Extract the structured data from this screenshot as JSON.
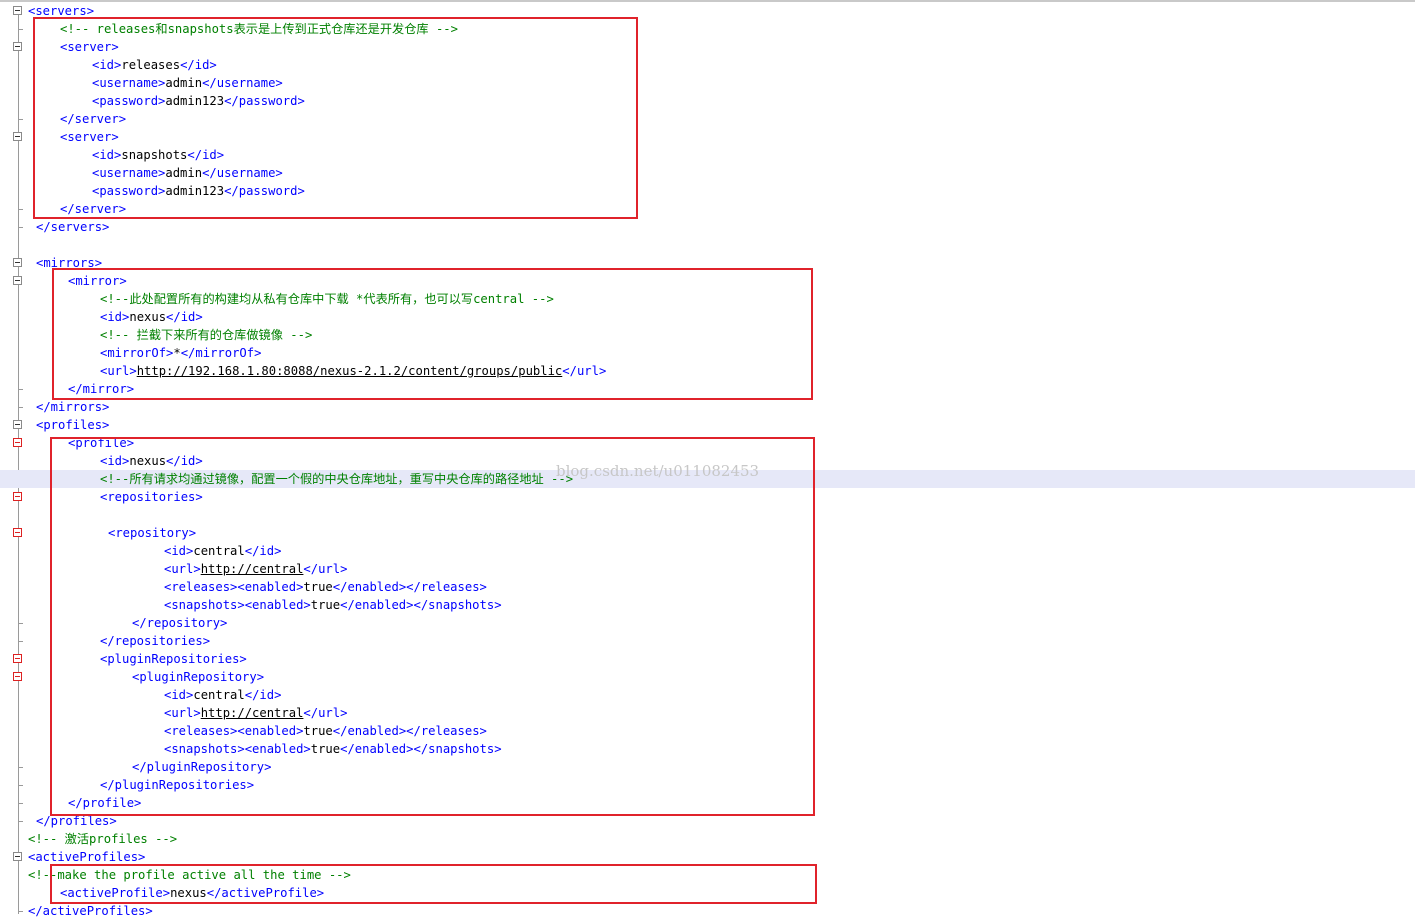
{
  "watermark": "blog.csdn.net/u011082453",
  "lines": [
    {
      "indent": 0,
      "fold": "box",
      "segs": [
        [
          "tag",
          "<servers>"
        ]
      ]
    },
    {
      "indent": 4,
      "fold": "tick",
      "segs": [
        [
          "cmt",
          "<!-- releases和snapshots表示是上传到正式仓库还是开发仓库 -->"
        ]
      ]
    },
    {
      "indent": 4,
      "fold": "box",
      "segs": [
        [
          "tag",
          "<server>"
        ]
      ]
    },
    {
      "indent": 8,
      "fold": "line",
      "segs": [
        [
          "tag",
          "<id>"
        ],
        [
          "txt",
          "releases"
        ],
        [
          "tag",
          "</id>"
        ]
      ]
    },
    {
      "indent": 8,
      "fold": "line",
      "segs": [
        [
          "tag",
          "<username>"
        ],
        [
          "txt",
          "admin"
        ],
        [
          "tag",
          "</username>"
        ]
      ]
    },
    {
      "indent": 8,
      "fold": "line",
      "segs": [
        [
          "tag",
          "<password>"
        ],
        [
          "txt",
          "admin123"
        ],
        [
          "tag",
          "</password>"
        ]
      ]
    },
    {
      "indent": 4,
      "fold": "tick",
      "segs": [
        [
          "tag",
          "</server>"
        ]
      ]
    },
    {
      "indent": 4,
      "fold": "box",
      "segs": [
        [
          "tag",
          "<server>"
        ]
      ]
    },
    {
      "indent": 8,
      "fold": "line",
      "segs": [
        [
          "tag",
          "<id>"
        ],
        [
          "txt",
          "snapshots"
        ],
        [
          "tag",
          "</id>"
        ]
      ]
    },
    {
      "indent": 8,
      "fold": "line",
      "segs": [
        [
          "tag",
          "<username>"
        ],
        [
          "txt",
          "admin"
        ],
        [
          "tag",
          "</username>"
        ]
      ]
    },
    {
      "indent": 8,
      "fold": "line",
      "segs": [
        [
          "tag",
          "<password>"
        ],
        [
          "txt",
          "admin123"
        ],
        [
          "tag",
          "</password>"
        ]
      ]
    },
    {
      "indent": 4,
      "fold": "tick",
      "segs": [
        [
          "tag",
          "</server>"
        ]
      ]
    },
    {
      "indent": 1,
      "fold": "tick",
      "segs": [
        [
          "tag",
          "</servers>"
        ]
      ]
    },
    {
      "indent": 0,
      "fold": "line",
      "segs": []
    },
    {
      "indent": 1,
      "fold": "box",
      "segs": [
        [
          "tag",
          "<mirrors>"
        ]
      ]
    },
    {
      "indent": 5,
      "fold": "box",
      "segs": [
        [
          "tag",
          "<mirror>"
        ]
      ]
    },
    {
      "indent": 9,
      "fold": "line",
      "segs": [
        [
          "cmt",
          "<!--此处配置所有的构建均从私有仓库中下载 *代表所有，也可以写central -->"
        ]
      ]
    },
    {
      "indent": 9,
      "fold": "line",
      "segs": [
        [
          "tag",
          "<id>"
        ],
        [
          "txt",
          "nexus"
        ],
        [
          "tag",
          "</id>"
        ]
      ]
    },
    {
      "indent": 9,
      "fold": "line",
      "segs": [
        [
          "cmt",
          "<!-- 拦截下来所有的仓库做镜像 -->"
        ]
      ]
    },
    {
      "indent": 9,
      "fold": "line",
      "segs": [
        [
          "tag",
          "<mirrorOf>"
        ],
        [
          "txt",
          "*"
        ],
        [
          "tag",
          "</mirrorOf>"
        ]
      ]
    },
    {
      "indent": 9,
      "fold": "line",
      "segs": [
        [
          "tag",
          "<url>"
        ],
        [
          "lnk",
          "http://192.168.1.80:8088/nexus-2.1.2/content/groups/public"
        ],
        [
          "tag",
          "</url>"
        ]
      ]
    },
    {
      "indent": 5,
      "fold": "tick",
      "segs": [
        [
          "tag",
          "</mirror>"
        ]
      ]
    },
    {
      "indent": 1,
      "fold": "tick",
      "segs": [
        [
          "tag",
          "</mirrors>"
        ]
      ]
    },
    {
      "indent": 1,
      "fold": "box",
      "segs": [
        [
          "tag",
          "<profiles>"
        ]
      ]
    },
    {
      "indent": 5,
      "fold": "red",
      "segs": [
        [
          "tag",
          "<profile>"
        ]
      ]
    },
    {
      "indent": 9,
      "fold": "line",
      "segs": [
        [
          "tag",
          "<id>"
        ],
        [
          "txt",
          "nexus"
        ],
        [
          "tag",
          "</id>"
        ]
      ]
    },
    {
      "indent": 9,
      "fold": "line",
      "hl": true,
      "segs": [
        [
          "cmt",
          "<!--所有请求均通过镜像，配置一个假的中央仓库地址，重写中央仓库的路径地址 -->"
        ]
      ]
    },
    {
      "indent": 9,
      "fold": "red",
      "segs": [
        [
          "tag",
          "<repositories>"
        ]
      ]
    },
    {
      "indent": 0,
      "fold": "line",
      "segs": []
    },
    {
      "indent": 10,
      "fold": "red",
      "segs": [
        [
          "tag",
          "<repository>"
        ]
      ]
    },
    {
      "indent": 17,
      "fold": "line",
      "segs": [
        [
          "tag",
          "<id>"
        ],
        [
          "txt",
          "central"
        ],
        [
          "tag",
          "</id>"
        ]
      ]
    },
    {
      "indent": 17,
      "fold": "line",
      "segs": [
        [
          "tag",
          "<url>"
        ],
        [
          "lnk",
          "http://central"
        ],
        [
          "tag",
          "</url>"
        ]
      ]
    },
    {
      "indent": 17,
      "fold": "line",
      "segs": [
        [
          "tag",
          "<releases><enabled>"
        ],
        [
          "txt",
          "true"
        ],
        [
          "tag",
          "</enabled></releases>"
        ]
      ]
    },
    {
      "indent": 17,
      "fold": "line",
      "segs": [
        [
          "tag",
          "<snapshots><enabled>"
        ],
        [
          "txt",
          "true"
        ],
        [
          "tag",
          "</enabled></snapshots>"
        ]
      ]
    },
    {
      "indent": 13,
      "fold": "tick",
      "segs": [
        [
          "tag",
          "</repository>"
        ]
      ]
    },
    {
      "indent": 9,
      "fold": "tick",
      "segs": [
        [
          "tag",
          "</repositories>"
        ]
      ]
    },
    {
      "indent": 9,
      "fold": "red",
      "segs": [
        [
          "tag",
          "<pluginRepositories>"
        ]
      ]
    },
    {
      "indent": 13,
      "fold": "red",
      "segs": [
        [
          "tag",
          "<pluginRepository>"
        ]
      ]
    },
    {
      "indent": 17,
      "fold": "line",
      "segs": [
        [
          "tag",
          "<id>"
        ],
        [
          "txt",
          "central"
        ],
        [
          "tag",
          "</id>"
        ]
      ]
    },
    {
      "indent": 17,
      "fold": "line",
      "segs": [
        [
          "tag",
          "<url>"
        ],
        [
          "lnk",
          "http://central"
        ],
        [
          "tag",
          "</url>"
        ]
      ]
    },
    {
      "indent": 17,
      "fold": "line",
      "segs": [
        [
          "tag",
          "<releases><enabled>"
        ],
        [
          "txt",
          "true"
        ],
        [
          "tag",
          "</enabled></releases>"
        ]
      ]
    },
    {
      "indent": 17,
      "fold": "line",
      "segs": [
        [
          "tag",
          "<snapshots><enabled>"
        ],
        [
          "txt",
          "true"
        ],
        [
          "tag",
          "</enabled></snapshots>"
        ]
      ]
    },
    {
      "indent": 13,
      "fold": "tick",
      "segs": [
        [
          "tag",
          "</pluginRepository>"
        ]
      ]
    },
    {
      "indent": 9,
      "fold": "tick",
      "segs": [
        [
          "tag",
          "</pluginRepositories>"
        ]
      ]
    },
    {
      "indent": 5,
      "fold": "tick",
      "segs": [
        [
          "tag",
          "</profile>"
        ]
      ]
    },
    {
      "indent": 1,
      "fold": "tick",
      "segs": [
        [
          "tag",
          "</profiles>"
        ]
      ]
    },
    {
      "indent": 0,
      "fold": "line",
      "segs": [
        [
          "cmt",
          "<!-- 激活profiles -->"
        ]
      ]
    },
    {
      "indent": 0,
      "fold": "box",
      "segs": [
        [
          "tag",
          "<activeProfiles>"
        ]
      ]
    },
    {
      "indent": 0,
      "fold": "line",
      "segs": [
        [
          "cmt",
          "<!--make the profile active all the time -->"
        ]
      ]
    },
    {
      "indent": 4,
      "fold": "line",
      "segs": [
        [
          "tag",
          "<activeProfile>"
        ],
        [
          "txt",
          "nexus"
        ],
        [
          "tag",
          "</activeProfile>"
        ]
      ]
    },
    {
      "indent": 0,
      "fold": "tick",
      "segs": [
        [
          "tag",
          "</activeProfiles>"
        ]
      ]
    }
  ]
}
